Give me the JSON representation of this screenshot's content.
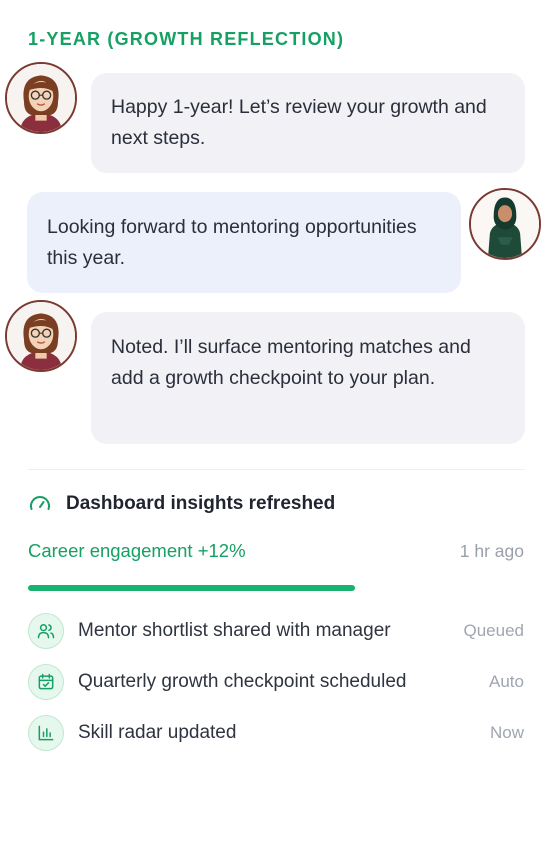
{
  "section": {
    "title": "1-YEAR (GROWTH REFLECTION)"
  },
  "messages": [
    {
      "sender": "assistant",
      "text": "Happy 1-year! Let’s review your growth and next steps."
    },
    {
      "sender": "user",
      "text": "Looking forward to mentoring opportunities this year."
    },
    {
      "sender": "assistant",
      "text": "Noted. I’ll surface mentoring matches and add a growth checkpoint to your plan."
    }
  ],
  "insights": {
    "title": "Dashboard insights refreshed",
    "metric_label": "Career engagement +12%",
    "metric_time": "1 hr ago",
    "progress_fraction": 0.66
  },
  "activities": [
    {
      "icon": "users-icon",
      "label": "Mentor shortlist shared with manager",
      "status": "Queued"
    },
    {
      "icon": "calendar-check-icon",
      "label": "Quarterly growth checkpoint scheduled",
      "status": "Auto"
    },
    {
      "icon": "bar-chart-icon",
      "label": "Skill radar updated",
      "status": "Now"
    }
  ],
  "colors": {
    "accent": "#16a064",
    "bar": "#18b36f",
    "ai_bubble": "#f1f1f6",
    "user_bubble": "#ebf0fb"
  }
}
